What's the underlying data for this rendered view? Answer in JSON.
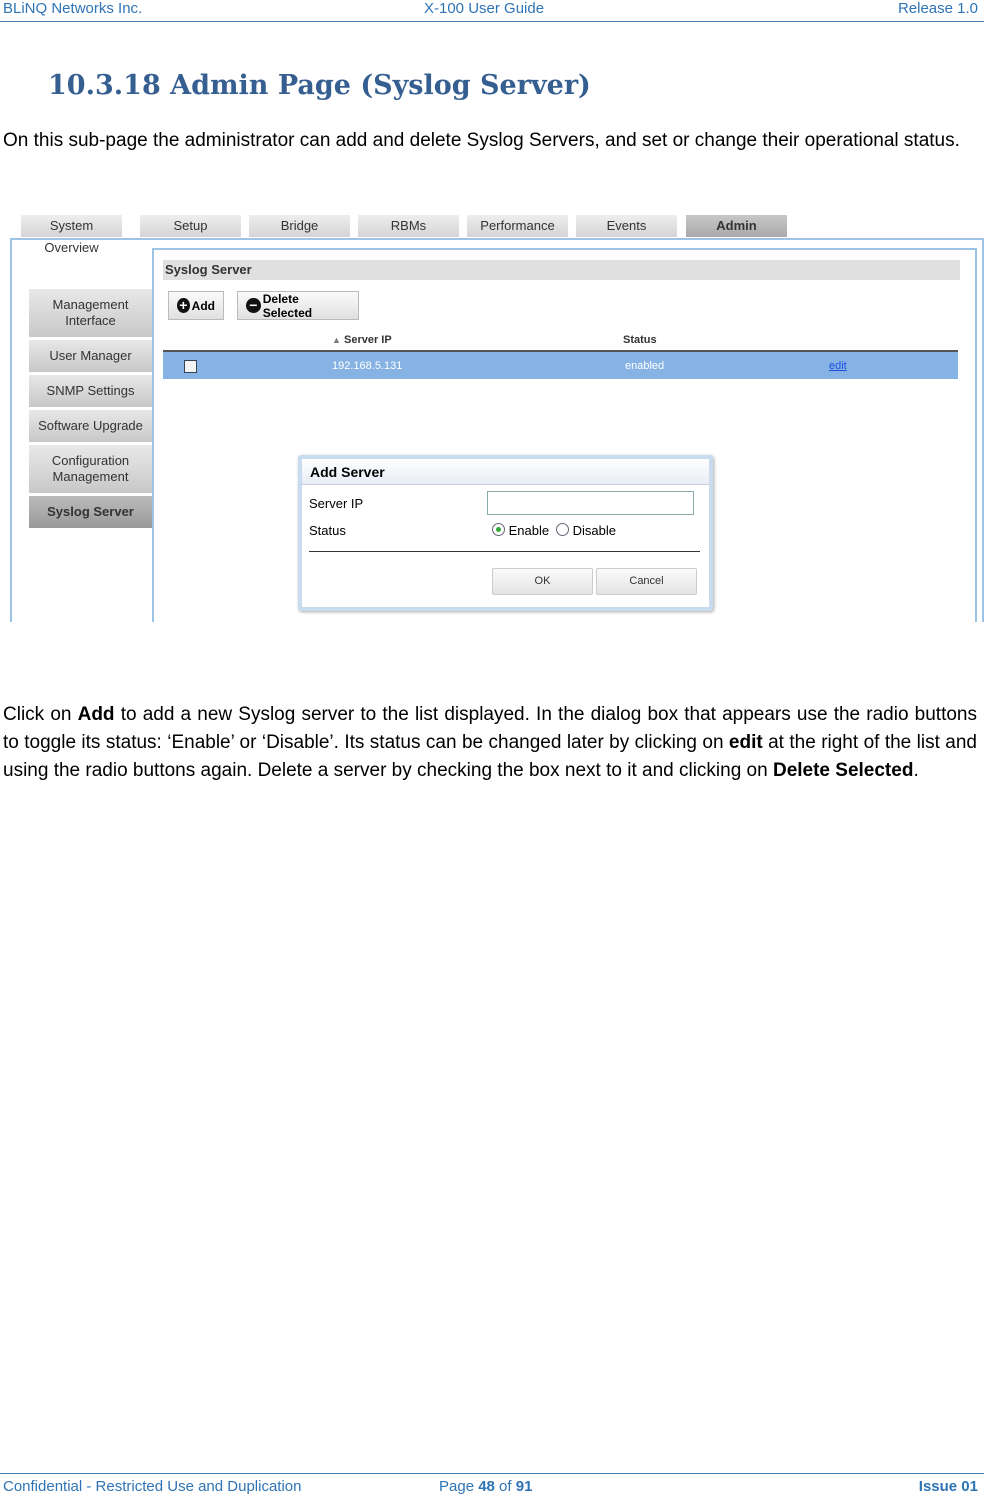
{
  "header": {
    "left": "BLiNQ Networks Inc.",
    "center": "X-100 User Guide",
    "right": "Release 1.0"
  },
  "title": "10.3.18 Admin Page (Syslog Server)",
  "intro": "On this sub-page the administrator can add and delete Syslog Servers, and set or change their operational status.",
  "ui": {
    "tabs": [
      "System Overview",
      "Setup",
      "Bridge",
      "RBMs",
      "Performance",
      "Events",
      "Admin"
    ],
    "active_tab": "Admin",
    "sidebar": [
      "Management Interface",
      "User Manager",
      "SNMP Settings",
      "Software Upgrade",
      "Configuration Management",
      "Syslog Server"
    ],
    "panel_title": "Syslog Server",
    "add_label": "Add",
    "delete_label": "Delete Selected",
    "columns": [
      "Server IP",
      "Status"
    ],
    "rows": [
      {
        "ip": "192.168.5.131",
        "status": "enabled",
        "action": "edit"
      }
    ],
    "dialog": {
      "title": "Add Server",
      "ip_label": "Server IP",
      "ip_value": "",
      "status_label": "Status",
      "enable": "Enable",
      "disable": "Disable",
      "selected": "Enable",
      "ok": "OK",
      "cancel": "Cancel"
    },
    "colors": {
      "frame": "#9dc3e6",
      "selected_row": "#86b3e3"
    }
  },
  "body": {
    "t1": "Click on ",
    "b1": "Add",
    "t2": " to add a new Syslog server to the list displayed. In the dialog box that appears use the radio buttons to toggle its status: ‘Enable’ or ‘Disable’.  Its status can be changed later by clicking on ",
    "b2": "edit",
    "t3": " at the right of the list and using the radio buttons again. Delete a server by checking the box next to it and clicking on ",
    "b3": "Delete Selected",
    "t4": "."
  },
  "footer": {
    "left": "Confidential - Restricted Use and Duplication",
    "page_prefix": "Page ",
    "page": "48",
    "of": " of ",
    "total": "91",
    "right": "Issue 01"
  }
}
